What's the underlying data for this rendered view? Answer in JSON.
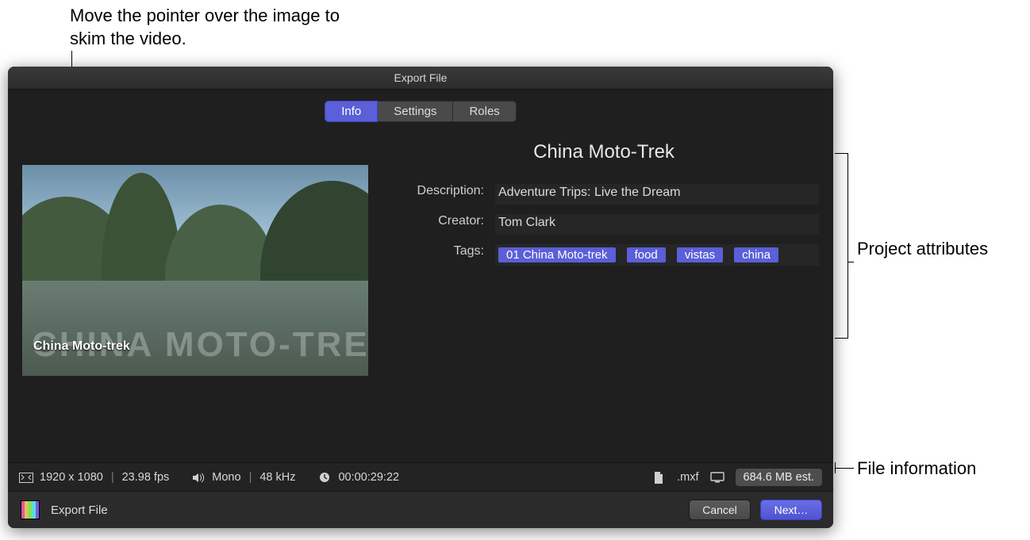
{
  "callouts": {
    "top": "Move the pointer over the image to skim the video.",
    "attributes": "Project attributes",
    "file_info": "File information"
  },
  "window": {
    "title": "Export File"
  },
  "tabs": {
    "info": "Info",
    "settings": "Settings",
    "roles": "Roles"
  },
  "preview": {
    "overlay_big": "CHINA MOTO-TREK",
    "caption": "China Moto-trek"
  },
  "project": {
    "title": "China Moto-Trek",
    "description_label": "Description:",
    "description": "Adventure Trips: Live the Dream",
    "creator_label": "Creator:",
    "creator": "Tom Clark",
    "tags_label": "Tags:",
    "tags": {
      "t0": "01 China Moto-trek",
      "t1": "food",
      "t2": "vistas",
      "t3": "china"
    }
  },
  "status": {
    "resolution": "1920 x 1080",
    "fps": "23.98 fps",
    "audio_channels": "Mono",
    "audio_rate": "48 kHz",
    "duration": "00:00:29:22",
    "container": ".mxf",
    "size_estimate": "684.6 MB est."
  },
  "footer": {
    "preset_name": "Export File",
    "cancel": "Cancel",
    "next": "Next…"
  }
}
